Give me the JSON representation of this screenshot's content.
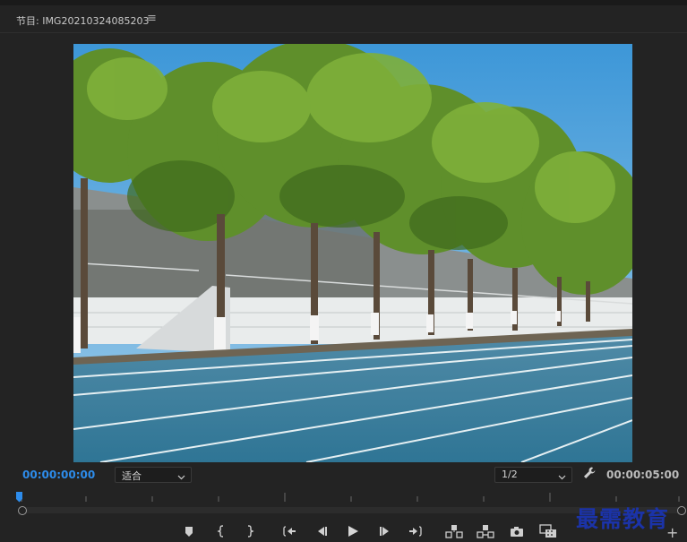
{
  "panel": {
    "title": "节目: IMG20210324085203",
    "menu_icon": "hamburger-icon"
  },
  "viewer": {
    "content": "video-frame-preview"
  },
  "status": {
    "current_timecode": "00:00:00:00",
    "zoom_value": "适合",
    "resolution_value": "1/2",
    "duration_timecode": "00:00:05:00",
    "settings_icon": "wrench-icon"
  },
  "timeline": {
    "playhead_position": 0.0
  },
  "transport": {
    "buttons": [
      {
        "name": "add-marker-button",
        "icon": "marker-icon"
      },
      {
        "name": "mark-in-button",
        "icon": "mark-in-icon"
      },
      {
        "name": "mark-out-button",
        "icon": "mark-out-icon"
      },
      {
        "name": "go-to-in-button",
        "icon": "go-to-in-icon"
      },
      {
        "name": "step-back-button",
        "icon": "step-back-icon"
      },
      {
        "name": "play-button",
        "icon": "play-icon"
      },
      {
        "name": "step-forward-button",
        "icon": "step-forward-icon"
      },
      {
        "name": "go-to-out-button",
        "icon": "go-to-out-icon"
      },
      {
        "name": "lift-button",
        "icon": "lift-icon"
      },
      {
        "name": "extract-button",
        "icon": "extract-icon"
      },
      {
        "name": "export-frame-button",
        "icon": "camera-icon"
      },
      {
        "name": "comparison-view-button",
        "icon": "comparison-view-icon"
      }
    ],
    "add_label": "+"
  },
  "watermark": {
    "text": "最需教育"
  },
  "colors": {
    "panel_bg": "#232323",
    "timecode_blue": "#2d8ceb",
    "watermark_blue": "#1b33a8"
  }
}
